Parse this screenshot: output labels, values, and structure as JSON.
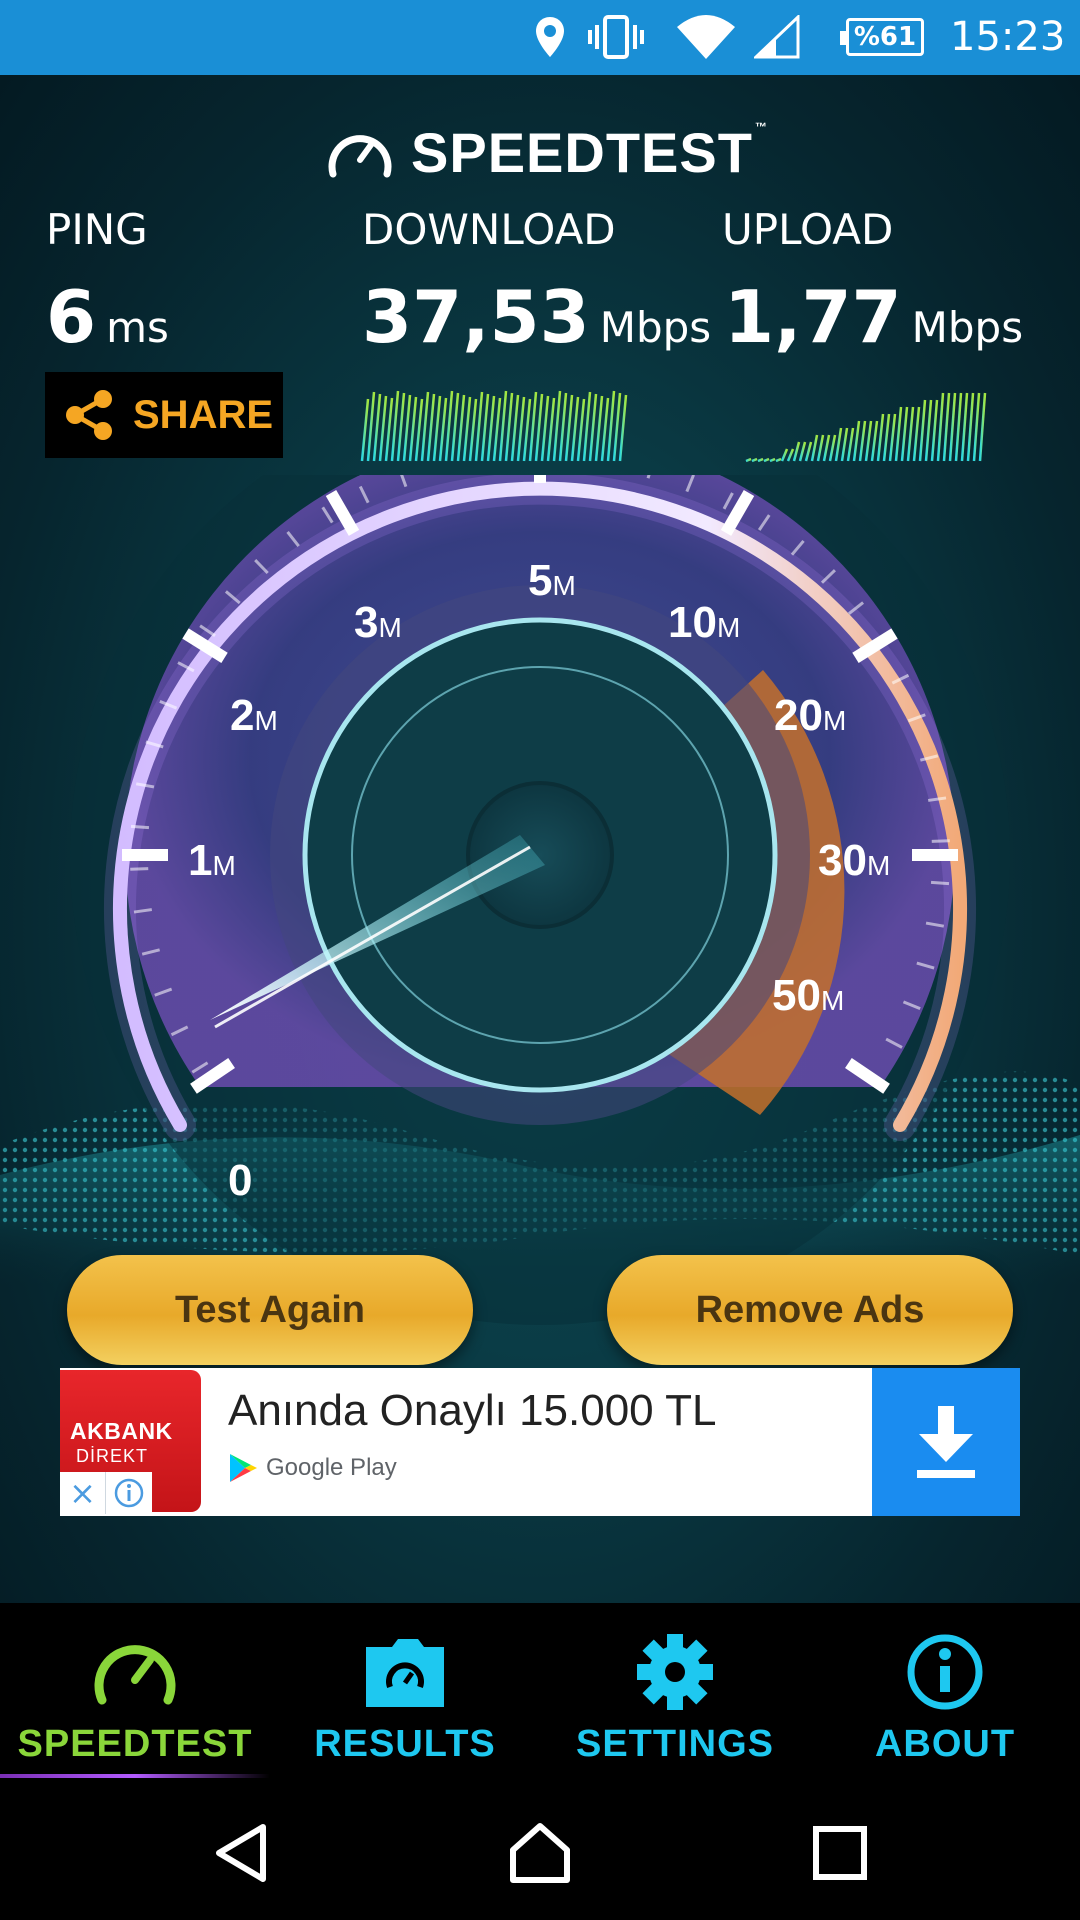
{
  "status_bar": {
    "battery": "%61",
    "time": "15:23",
    "icons": [
      "location-icon",
      "vibrate-icon",
      "wifi-icon",
      "cell-signal-icon",
      "battery-icon"
    ]
  },
  "app": {
    "logo_text": "SPEEDTEST",
    "logo_tm": "™"
  },
  "stats": {
    "ping": {
      "label": "PING",
      "value": "6",
      "unit": "ms"
    },
    "download": {
      "label": "DOWNLOAD",
      "value": "37,53",
      "unit": "Mbps"
    },
    "upload": {
      "label": "UPLOAD",
      "value": "1,77",
      "unit": "Mbps"
    }
  },
  "share": {
    "label": "SHARE"
  },
  "gauge": {
    "ticks": [
      {
        "num": "0",
        "unit": ""
      },
      {
        "num": "1",
        "unit": "M"
      },
      {
        "num": "2",
        "unit": "M"
      },
      {
        "num": "3",
        "unit": "M"
      },
      {
        "num": "5",
        "unit": "M"
      },
      {
        "num": "10",
        "unit": "M"
      },
      {
        "num": "20",
        "unit": "M"
      },
      {
        "num": "30",
        "unit": "M"
      },
      {
        "num": "50",
        "unit": "M"
      }
    ]
  },
  "buttons": {
    "test_again": "Test Again",
    "remove_ads": "Remove Ads"
  },
  "ad": {
    "brand_line1": "AKBANK",
    "brand_line2": "DİREKT",
    "title": "Anında Onaylı 15.000 TL",
    "store": "Google Play"
  },
  "tabs": [
    {
      "label": "SPEEDTEST",
      "active": true,
      "color": "#8ad63a"
    },
    {
      "label": "RESULTS",
      "active": false,
      "color": "#1ec8f0"
    },
    {
      "label": "SETTINGS",
      "active": false,
      "color": "#1ec8f0"
    },
    {
      "label": "ABOUT",
      "active": false,
      "color": "#1ec8f0"
    }
  ],
  "colors": {
    "status_bar": "#1a8fd6",
    "accent_orange": "#f5a623",
    "accent_cyan": "#1ec8f0",
    "accent_green": "#8ad63a",
    "button_gold": "#e8a92a"
  }
}
